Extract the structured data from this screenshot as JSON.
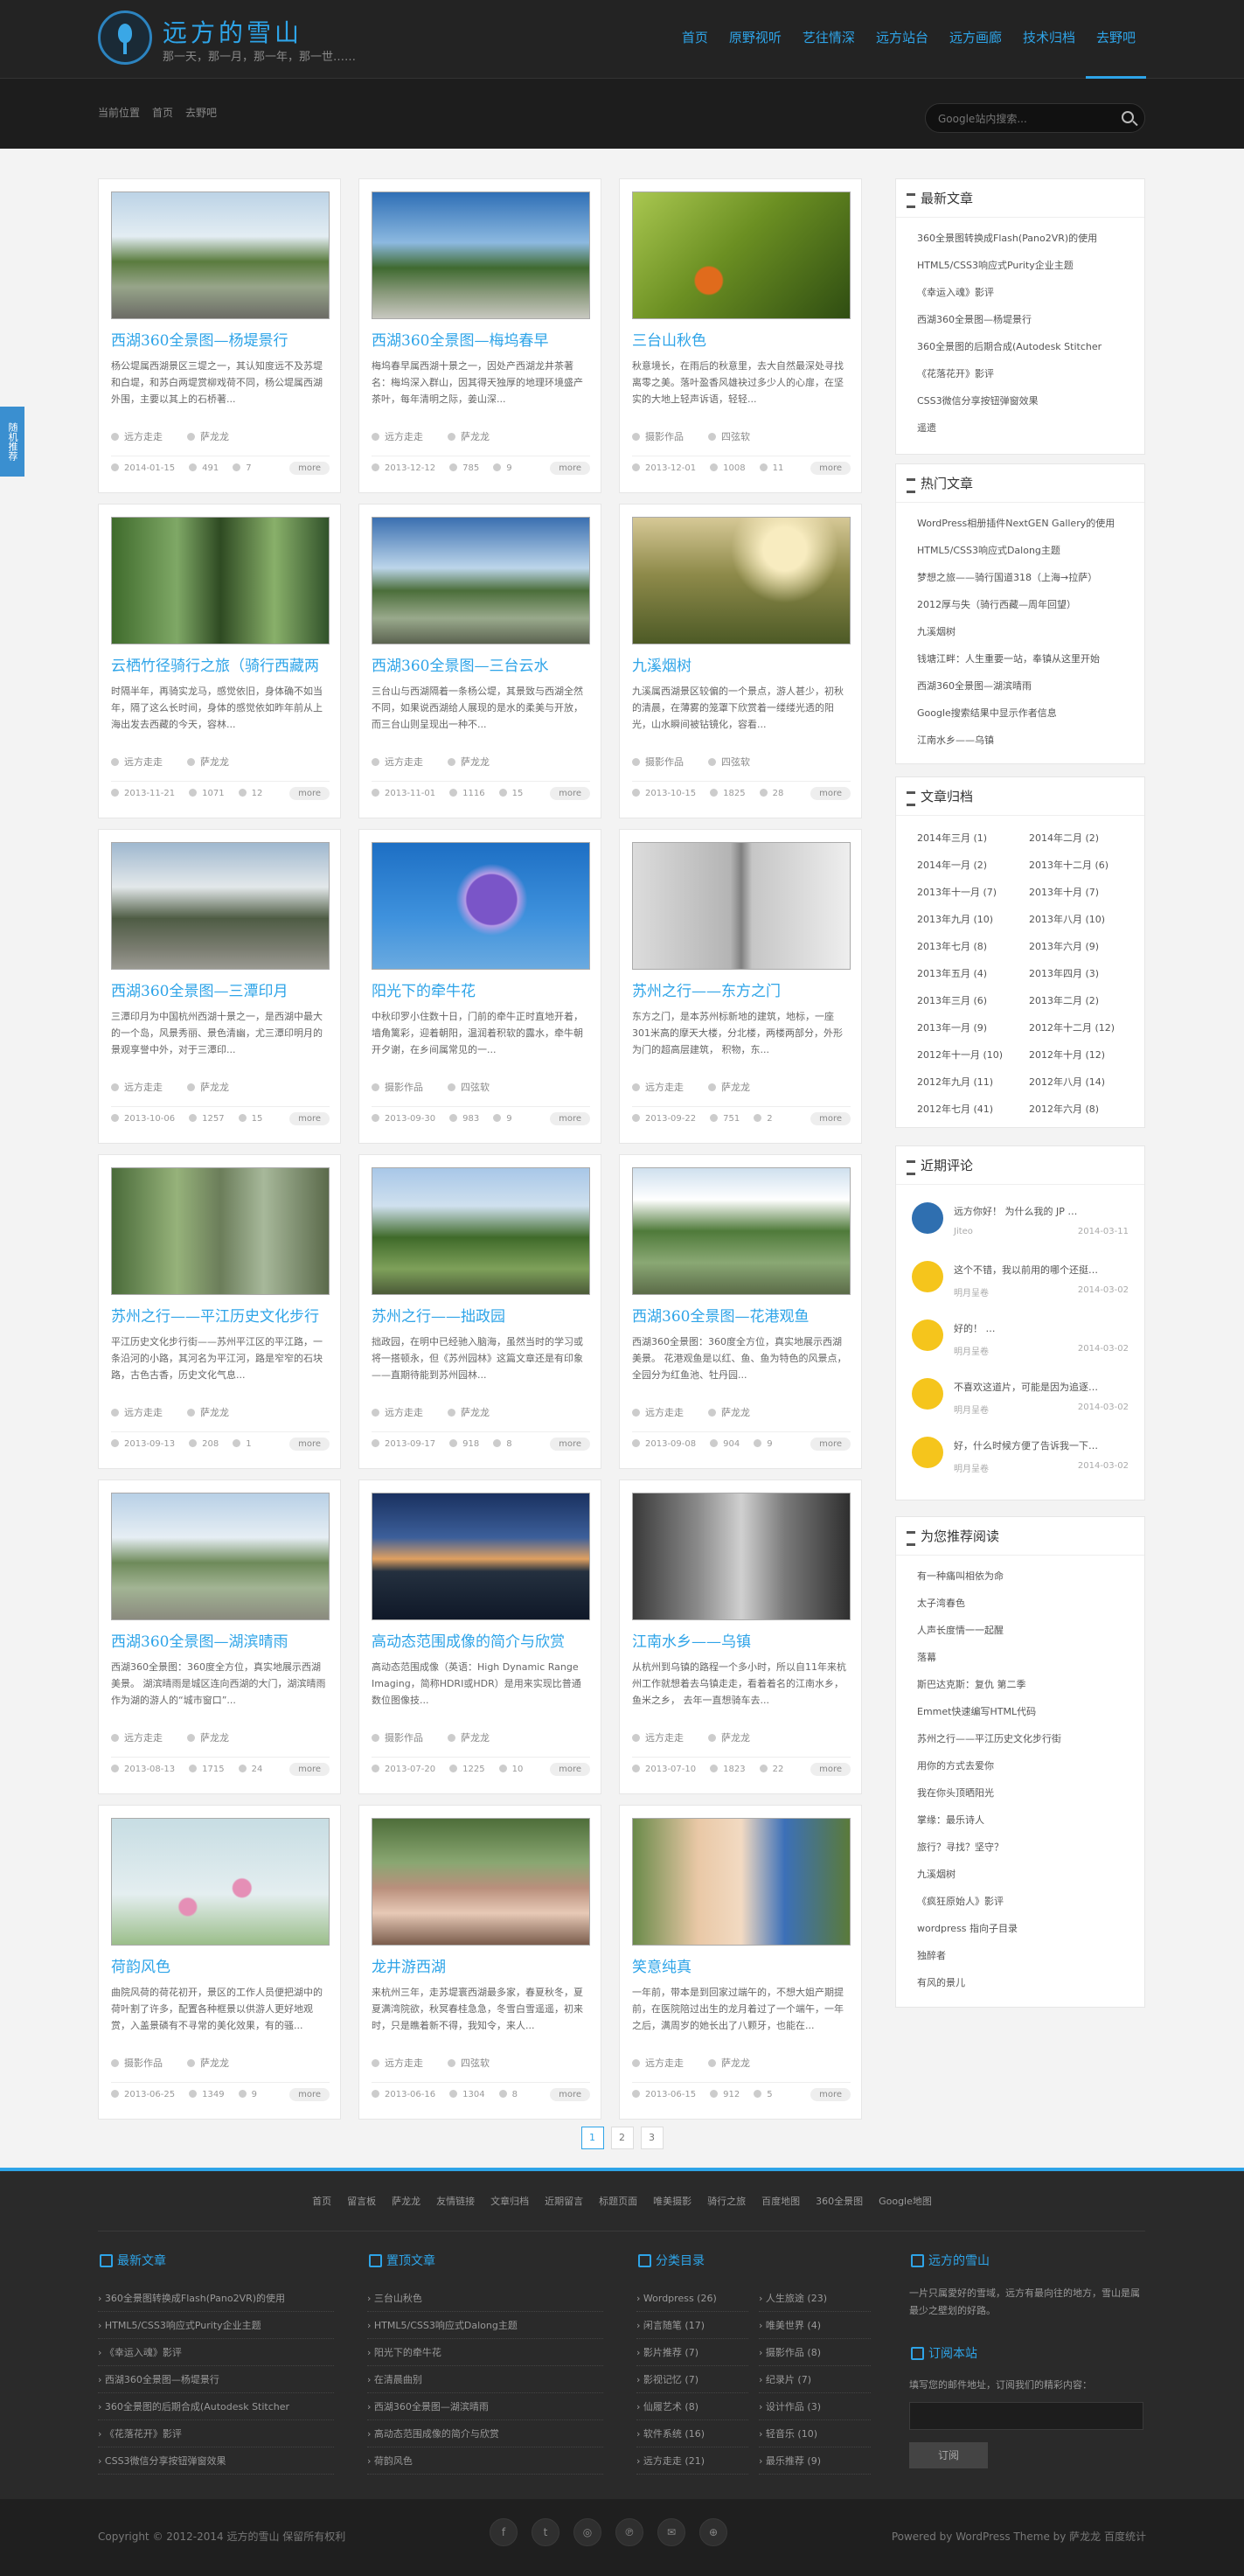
{
  "site": {
    "title": "远方的雪山",
    "subtitle": "那一天，那一月，那一年，那一世……"
  },
  "nav": [
    "首页",
    "原野视听",
    "艺往情深",
    "远方站台",
    "远方画廊",
    "技术归档",
    "去野吧"
  ],
  "breadcrumb": [
    "当前位置",
    "首页",
    "去野吧"
  ],
  "search": {
    "placeholder": "Google站内搜索..."
  },
  "sidetab": "随机推荐",
  "colors": {
    "accent": "#2ea4e8",
    "header": "#232323",
    "footer": "#2a2a2a"
  },
  "posts": [
    {
      "title": "西湖360全景图—杨堤景行",
      "excerpt": "杨公堤属西湖景区三堤之一，其认知度远不及苏堤和白堤，和苏白两堤赏柳戏荷不同，杨公堤属西湖外围，主要以其上的石桥著...",
      "cat": "远方走走",
      "author": "萨龙龙",
      "date": "2014-01-15",
      "views": "491",
      "comments": "7",
      "more": "more",
      "thumb": "linear-gradient(#bcd3e6 0%,#e3edf3 35%,#5a7b3e 55%,#97a58a 75%,#6b6b65 100%)"
    },
    {
      "title": "西湖360全景图—梅坞春早",
      "excerpt": "梅坞春早属西湖十景之一，因处产西湖龙井茶著名：梅坞深入群山，因其得天独厚的地理环境盛产茶叶，每年清明之际，姜山深...",
      "cat": "远方走走",
      "author": "萨龙龙",
      "date": "2013-12-12",
      "views": "785",
      "comments": "9",
      "more": "more",
      "thumb": "linear-gradient(#2f6fb6 0%,#8cb9e0 40%,#3f6a30 60%,#8a9a7c 80%,#c8c8c0 100%)"
    },
    {
      "title": "三台山秋色",
      "excerpt": "秋意境长，在雨后的秋意里，去大自然最深处寻找离零之美。落叶盈香风雄袂过多少人的心扉，在坚实的大地上轻声诉语，轻轻...",
      "cat": "摄影作品",
      "author": "四弦软",
      "date": "2013-12-01",
      "views": "1008",
      "comments": "11",
      "more": "more",
      "thumb": "radial-gradient(circle at 35% 70%,#e06b1c 0 8%,transparent 9%),linear-gradient(135deg,#a9c750 0%,#6b8f22 45%,#2f4d12 100%)"
    },
    {
      "title": "云栖竹径骑行之旅（骑行西藏两",
      "excerpt": "时隔半年，再骑实龙马，感觉依旧，身体确不如当年，隔了这么长时间，身体的感觉依如昨年前从上海出发去西藏的今天，容林...",
      "cat": "远方走走",
      "author": "萨龙龙",
      "date": "2013-11-21",
      "views": "1071",
      "comments": "12",
      "more": "more",
      "thumb": "linear-gradient(90deg,#3f6b2c 0%,#7fa866 30%,#2e4a22 50%,#89b06a 75%,#31522a 100%)"
    },
    {
      "title": "西湖360全景图—三台云水",
      "excerpt": "三台山与西湖隔着一条杨公堤，其景致与西湖全然不同，如果说西湖给人展现的是水的柔美与开放，而三台山则呈现出一种不...",
      "cat": "远方走走",
      "author": "萨龙龙",
      "date": "2013-11-01",
      "views": "1116",
      "comments": "15",
      "more": "more",
      "thumb": "linear-gradient(#3a6fb0 0%,#bcd5ea 40%,#4b6e3a 58%,#99a98c 80%,#5b6350 100%)"
    },
    {
      "title": "九溪烟树",
      "excerpt": "九溪属西湖景区较偏的一个景点，游人甚少，初秋的清晨，在薄雾的笼罩下欣赏着一缕缕光透的阳光，山水瞬间被钻镜化，容看...",
      "cat": "摄影作品",
      "author": "四弦软",
      "date": "2013-10-15",
      "views": "1825",
      "comments": "28",
      "more": "more",
      "thumb": "radial-gradient(circle at 70% 25%,#f8ecc0 0 12%,transparent 30%),linear-gradient(#d6c896 0%,#8e8a4a 45%,#4d5a26 100%)"
    },
    {
      "title": "西湖360全景图—三潭印月",
      "excerpt": "三潭印月为中国杭州西湖十景之一，是西湖中最大的一个岛，风景秀丽、景色清幽，尤三潭印明月的景观享誉中外，对于三潭印...",
      "cat": "远方走走",
      "author": "萨龙龙",
      "date": "2013-10-06",
      "views": "1257",
      "comments": "15",
      "more": "more",
      "thumb": "linear-gradient(#9fb8cf 0%,#e3e8ea 35%,#4e5c44 60%,#7c7e72 85%,#9a9a92 100%)"
    },
    {
      "title": "阳光下的牵牛花",
      "excerpt": "中秋印罗小住数十日，门前的牵牛正时直地开着，墙角篱彩，迎着朝阳，温润着积软的露水，牵牛朝开夕谢，在乡间属常见的一...",
      "cat": "摄影作品",
      "author": "四弦软",
      "date": "2013-09-30",
      "views": "983",
      "comments": "9",
      "more": "more",
      "thumb": "radial-gradient(circle at 55% 45%,#7a55c8 0 18%,#b59be6 19%,transparent 26%),linear-gradient(#1d6fc4 0%,#3f92dd 60%,#6aaae0 100%)"
    },
    {
      "title": "苏州之行——东方之门",
      "excerpt": "东方之门，是本苏州标新地的建筑，地标，一座301米高的摩天大楼，分北楼，两楼两部分，外形为门的超高层建筑， 积物，东...",
      "cat": "远方走走",
      "author": "萨龙龙",
      "date": "2013-09-22",
      "views": "751",
      "comments": "2",
      "more": "more",
      "thumb": "linear-gradient(90deg,#dcdcdc 0%,#b4b4b4 45%,#808080 50%,#c6c6c6 55%,#eeeeee 100%)"
    },
    {
      "title": "苏州之行——平江历史文化步行",
      "excerpt": "平江历史文化步行街——苏州平江区的平江路，一条沿河的小路，其河名为平江河，路是窄窄的石块路，古色古香，历史文化气息...",
      "cat": "远方走走",
      "author": "萨龙龙",
      "date": "2013-09-13",
      "views": "208",
      "comments": "1",
      "more": "more",
      "thumb": "linear-gradient(90deg,#4a6b3a 0%,#96b27a 30%,#6b7d5a 50%,#a7b89a 70%,#5b6a4b 100%)"
    },
    {
      "title": "苏州之行——拙政园",
      "excerpt": "拙政园，在明中已经驰入脑海，虽然当时的学习或将一搭顿永，但《苏州园林》这篇文章还是有印象——直期待能到苏州园林...",
      "cat": "远方走走",
      "author": "萨龙龙",
      "date": "2013-09-17",
      "views": "918",
      "comments": "8",
      "more": "more",
      "thumb": "linear-gradient(#a8c7e8 0%,#cfe0ee 30%,#3f6a2a 55%,#7ea05a 80%,#4b5a38 100%)"
    },
    {
      "title": "西湖360全景图—花港观鱼",
      "excerpt": "西湖360全景图：360度全方位，真实地展示西湖美景。 花港观鱼是以红、鱼、鱼为特色的风景点，全园分为红鱼池、牡丹园...",
      "cat": "远方走走",
      "author": "萨龙龙",
      "date": "2013-09-08",
      "views": "904",
      "comments": "9",
      "more": "more",
      "thumb": "linear-gradient(#cfe0ee 0%,#ffffff 25%,#4f7a3a 50%,#8aa874 75%,#5b6b48 100%)"
    },
    {
      "title": "西湖360全景图—湖滨晴雨",
      "excerpt": "西湖360全景图：360度全方位，真实地展示西湖美景。 湖滨晴雨是城区连向西湖的大门，湖滨晴雨作为湖的游人的“城市窗口”...",
      "cat": "远方走走",
      "author": "萨龙龙",
      "date": "2013-08-13",
      "views": "1715",
      "comments": "24",
      "more": "more",
      "thumb": "linear-gradient(#b8d0e6 0%,#e6eef4 35%,#6e8a5a 55%,#a2b494 75%,#8a8a7e 100%)"
    },
    {
      "title": "高动态范围成像的简介与欣赏",
      "excerpt": "高动态范围成像（英语：High Dynamic Range Imaging，简称HDRI或HDR）是用来实现比普通数位图像技...",
      "cat": "摄影作品",
      "author": "萨龙龙",
      "date": "2013-07-20",
      "views": "1225",
      "comments": "10",
      "more": "more",
      "thumb": "linear-gradient(#1a3160 0%,#3c5f9a 35%,#e0a060 52%,#24303f 62%,#0f1828 100%)"
    },
    {
      "title": "江南水乡——乌镇",
      "excerpt": "从杭州到乌镇的路程一个多小时，所以自11年来杭州工作就想着去乌镇走走，看着着名的江南水乡，鱼米之乡， 去年一直想骑车去...",
      "cat": "远方走走",
      "author": "萨龙龙",
      "date": "2013-07-10",
      "views": "1823",
      "comments": "22",
      "more": "more",
      "thumb": "linear-gradient(90deg,#3a3a3a 0%,#8a8a8a 30%,#d0d0d0 50%,#7a7a7a 70%,#2f2f2f 100%)"
    },
    {
      "title": "荷韵风色",
      "excerpt": "曲院风荷的荷花初开，景区的工作人员便把湖中的荷叶割了许多，配置各种框景以供游人更好地观赏，入盖景磷有不寻常的美化效果，有的骚...",
      "cat": "摄影作品",
      "author": "萨龙龙",
      "date": "2013-06-25",
      "views": "1349",
      "comments": "9",
      "more": "more",
      "thumb": "radial-gradient(circle at 60% 55%,#e58fb6 0 6%,transparent 7%),radial-gradient(circle at 35% 70%,#e58fb6 0 5%,transparent 6%),linear-gradient(#c7dde3 0%,#e4eef0 60%,#9bbe8a 100%)"
    },
    {
      "title": "龙井游西湖",
      "excerpt": "来杭州三年，走苏堤寰西湖最多家，春夏秋冬，夏夏满湾院欲，秋冥春桂急急，冬雪白雪遥遥，初来时，只是瞧着新不得，我知令，来人...",
      "cat": "远方走走",
      "author": "四弦软",
      "date": "2013-06-16",
      "views": "1304",
      "comments": "8",
      "more": "more",
      "thumb": "linear-gradient(#4e6e3a 0%,#8aa772 35%,#b98f7c 55%,#e7c9b6 75%,#7a5c4c 100%)"
    },
    {
      "title": "笑意纯真",
      "excerpt": "一年前，带本是到回家过端午的，不想大姐产期提前，在医院陪过出生的龙月着过了一个端午，一年之后，满周岁的她长出了八颗牙，也能在...",
      "cat": "远方走走",
      "author": "萨龙龙",
      "date": "2013-06-15",
      "views": "912",
      "comments": "5",
      "more": "more",
      "thumb": "linear-gradient(90deg,#6a8a4a 0%,#e9c8a6 30%,#f2dac2 50%,#3c70b8 70%,#5a7a3a 100%)"
    }
  ],
  "sidebar": {
    "recent": {
      "title": "最新文章",
      "items": [
        "360全景图转换成Flash(Pano2VR)的使用",
        "HTML5/CSS3响应式Purity企业主题",
        "《幸运入魂》影评",
        "西湖360全景图—杨堤景行",
        "360全景图的后期合成(Autodesk Stitcher",
        "《花落花开》影评",
        "CSS3微信分享按钮弹窗效果",
        "遥遗"
      ]
    },
    "hot": {
      "title": "热门文章",
      "items": [
        "WordPress相册插件NextGEN Gallery的使用",
        "HTML5/CSS3响应式Dalong主题",
        "梦想之旅——骑行国道318（上海→拉萨）",
        "2012厚与失（骑行西藏—周年回望）",
        "九溪烟树",
        "钱塘江畔：人生重要一站，奉镇从这里开始",
        "西湖360全景图—湖滨晴雨",
        "Google搜索结果中显示作者信息",
        "江南水乡——乌镇"
      ]
    },
    "archive": {
      "title": "文章归档",
      "items": [
        "2014年三月 (1)",
        "2014年二月 (2)",
        "2014年一月 (2)",
        "2013年十二月 (6)",
        "2013年十一月 (7)",
        "2013年十月 (7)",
        "2013年九月 (10)",
        "2013年八月 (10)",
        "2013年七月 (8)",
        "2013年六月 (9)",
        "2013年五月 (4)",
        "2013年四月 (3)",
        "2013年三月 (6)",
        "2013年二月 (2)",
        "2013年一月 (9)",
        "2012年十二月 (12)",
        "2012年十一月 (10)",
        "2012年十月 (12)",
        "2012年九月 (11)",
        "2012年八月 (14)",
        "2012年七月 (41)",
        "2012年六月 (8)"
      ]
    },
    "comments": {
      "title": "近期评论",
      "items": [
        {
          "text": "远方你好！ 为什么我的 JP …",
          "author": "Jiteo",
          "date": "2014-03-11"
        },
        {
          "text": "这个不错，我以前用的哪个还挺…",
          "author": "明月呈卷",
          "date": "2014-03-02"
        },
        {
          "text": "好的！ …",
          "author": "明月呈卷",
          "date": "2014-03-02"
        },
        {
          "text": "不喜欢这道片，可能是因为追逐…",
          "author": "明月呈卷",
          "date": "2014-03-02"
        },
        {
          "text": "好，什么时候方便了告诉我一下…",
          "author": "明月呈卷",
          "date": "2014-03-02"
        }
      ]
    },
    "recommend": {
      "title": "为您推荐阅读",
      "items": [
        "有一种痛叫相依为命",
        "太子湾春色",
        "人声长度情一一起醒",
        "落幕",
        "斯巴达克斯：复仇 第二季",
        "Emmet快速编写HTML代码",
        "苏州之行——平江历史文化步行街",
        "用你的方式去爱你",
        "我在你头顶晒阳光",
        "掌缘：最乐诗人",
        "旅行？寻找？坚守？",
        "九溪烟树",
        "《疯狂原始人》影评",
        "wordpress 指向子目录",
        "独醉者",
        "有风的景儿"
      ]
    }
  },
  "pager": [
    "1",
    "2",
    "3"
  ],
  "footer": {
    "links": [
      "首页",
      "留言板",
      "萨龙龙",
      "友情链接",
      "文章归档",
      "近期留言",
      "标题页面",
      "唯美摄影",
      "骑行之旅",
      "百度地图",
      "360全景图",
      "Google地图"
    ],
    "col1": {
      "title": "最新文章",
      "items": [
        "360全景图转换成Flash(Pano2VR)的使用",
        "HTML5/CSS3响应式Purity企业主题",
        "《幸运入魂》影评",
        "西湖360全景图—杨堤景行",
        "360全景图的后期合成(Autodesk Stitcher",
        "《花落花开》影评",
        "CSS3微信分享按钮弹窗效果"
      ]
    },
    "col2": {
      "title": "置顶文章",
      "items": [
        "三台山秋色",
        "HTML5/CSS3响应式Dalong主题",
        "阳光下的牵牛花",
        "在清晨曲别",
        "西湖360全景图—湖滨晴雨",
        "高动态范围成像的简介与欣赏",
        "荷韵风色"
      ]
    },
    "col3": {
      "title": "分类目录",
      "items": [
        "Wordpress (26)",
        "人生旅途 (23)",
        "闲言随笔 (17)",
        "唯美世界 (4)",
        "影片推荐 (7)",
        "摄影作品 (8)",
        "影视记忆 (7)",
        "纪录片 (7)",
        "仙履艺术 (8)",
        "设计作品 (3)",
        "软件系统 (16)",
        "轻音乐 (10)",
        "远方走走 (21)",
        "最乐推荐 (9)"
      ]
    },
    "col4": {
      "title": "远方的雪山",
      "desc": "一片只属愛好的雪域，远方有最向往的地方，雪山是属最少之壁划的好路。",
      "sub_title": "订阅本站",
      "sub_desc": "填写您的邮件地址，订阅我们的精彩内容：",
      "sub_btn": "订阅"
    }
  },
  "bottom": {
    "copyright": "Copyright © 2012-2014 远方的雪山 保留所有权利",
    "powered": "Powered by WordPress Theme by 萨龙龙 百度统计",
    "social": [
      "f",
      "t",
      "◎",
      "℗",
      "✉",
      "⊕"
    ]
  }
}
